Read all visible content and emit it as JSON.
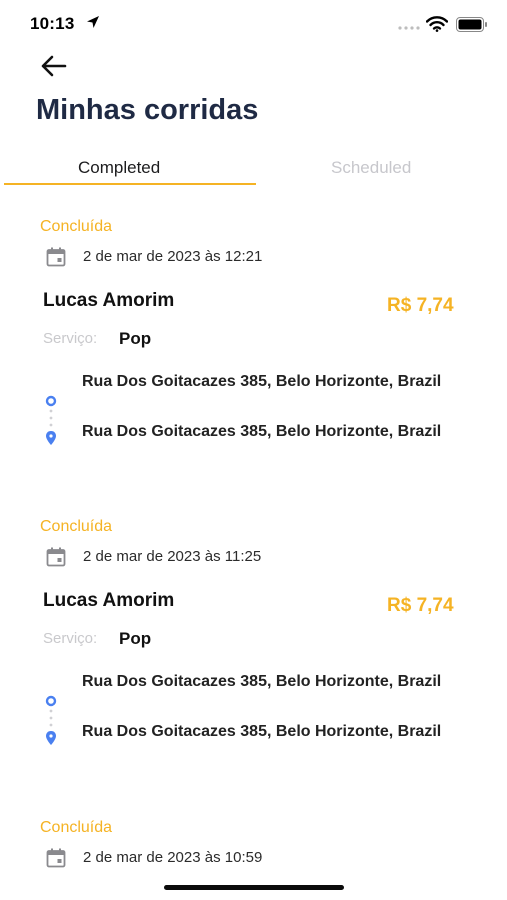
{
  "status_bar": {
    "time": "10:13"
  },
  "header": {
    "title": "Minhas corridas"
  },
  "tabs": [
    {
      "label": "Completed",
      "active": true
    },
    {
      "label": "Scheduled",
      "active": false
    }
  ],
  "rides": [
    {
      "status": "Concluída",
      "date": "2 de mar de 2023 às 12:21",
      "driver": "Lucas Amorim",
      "price": "R$ 7,74",
      "service_label": "Serviço:",
      "service": "Pop",
      "origin": "Rua Dos Goitacazes 385, Belo Horizonte, Brazil",
      "destination": "Rua Dos Goitacazes 385, Belo Horizonte, Brazil"
    },
    {
      "status": "Concluída",
      "date": "2 de mar de 2023 às 11:25",
      "driver": "Lucas Amorim",
      "price": "R$ 7,74",
      "service_label": "Serviço:",
      "service": "Pop",
      "origin": "Rua Dos Goitacazes 385, Belo Horizonte, Brazil",
      "destination": "Rua Dos Goitacazes 385, Belo Horizonte, Brazil"
    },
    {
      "status": "Concluída",
      "date": "2 de mar de 2023 às 10:59"
    }
  ],
  "colors": {
    "accent": "#f5b324",
    "title": "#1f2a44",
    "route_marker": "#4a80f0",
    "inactive_tab": "#c7c7cc"
  },
  "icons": [
    "location-arrow-icon",
    "wifi-icon",
    "battery-icon",
    "back-arrow-icon",
    "calendar-icon",
    "origin-marker-icon",
    "destination-pin-icon"
  ]
}
